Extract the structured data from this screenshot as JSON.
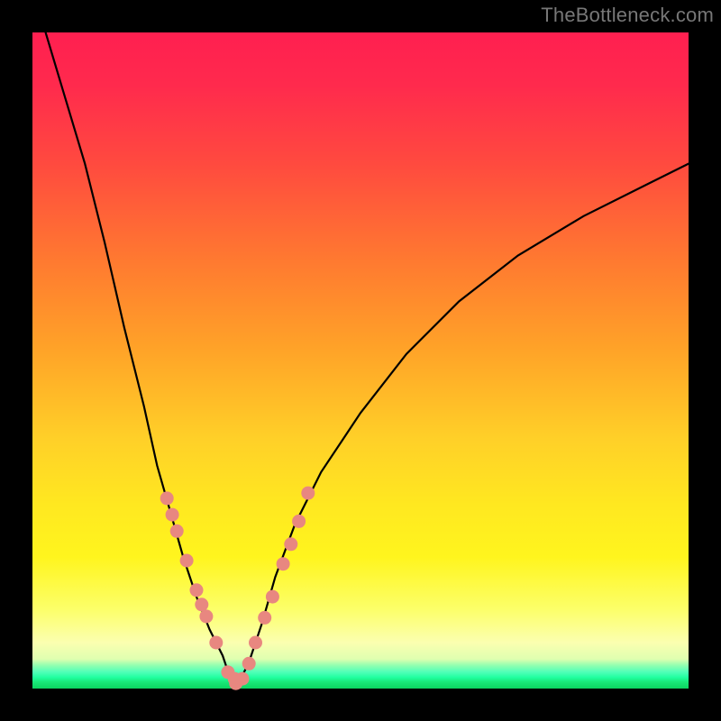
{
  "watermark": "TheBottleneck.com",
  "chart_data": {
    "type": "line",
    "title": "",
    "xlabel": "",
    "ylabel": "",
    "xlim": [
      0,
      100
    ],
    "ylim": [
      0,
      100
    ],
    "note": "Two overlaid curves on a red→green vertical gradient background. Values estimated from pixel positions; axes have no visible ticks or labels.",
    "series": [
      {
        "name": "left-curve",
        "x": [
          2,
          5,
          8,
          11,
          14,
          17,
          19,
          21,
          23,
          25,
          27,
          29,
          30,
          31
        ],
        "values": [
          100,
          90,
          80,
          68,
          55,
          43,
          34,
          27,
          20,
          14,
          9,
          5,
          2,
          0
        ]
      },
      {
        "name": "right-curve",
        "x": [
          31,
          33,
          35,
          37,
          40,
          44,
          50,
          57,
          65,
          74,
          84,
          94,
          100
        ],
        "values": [
          0,
          4,
          10,
          17,
          25,
          33,
          42,
          51,
          59,
          66,
          72,
          77,
          80
        ]
      }
    ],
    "dots_left": {
      "name": "left-dots",
      "x": [
        20.5,
        21.3,
        22.0,
        23.5,
        25.0,
        25.8,
        26.5,
        28.0,
        29.8,
        30.8
      ],
      "values": [
        29.0,
        26.5,
        24.0,
        19.5,
        15.0,
        12.8,
        11.0,
        7.0,
        2.5,
        1.5
      ]
    },
    "dots_right": {
      "name": "right-dots",
      "x": [
        31.0,
        32.0,
        33.0,
        34.0,
        35.4,
        36.6,
        38.2,
        39.4,
        40.6,
        42.0
      ],
      "values": [
        0.8,
        1.5,
        3.8,
        7.0,
        10.8,
        14.0,
        19.0,
        22.0,
        25.5,
        29.8
      ]
    },
    "gradient_stops": [
      {
        "pos": 0,
        "color": "#ff1f50"
      },
      {
        "pos": 50,
        "color": "#ffc028"
      },
      {
        "pos": 90,
        "color": "#fff840"
      },
      {
        "pos": 100,
        "color": "#0cd460"
      }
    ]
  }
}
